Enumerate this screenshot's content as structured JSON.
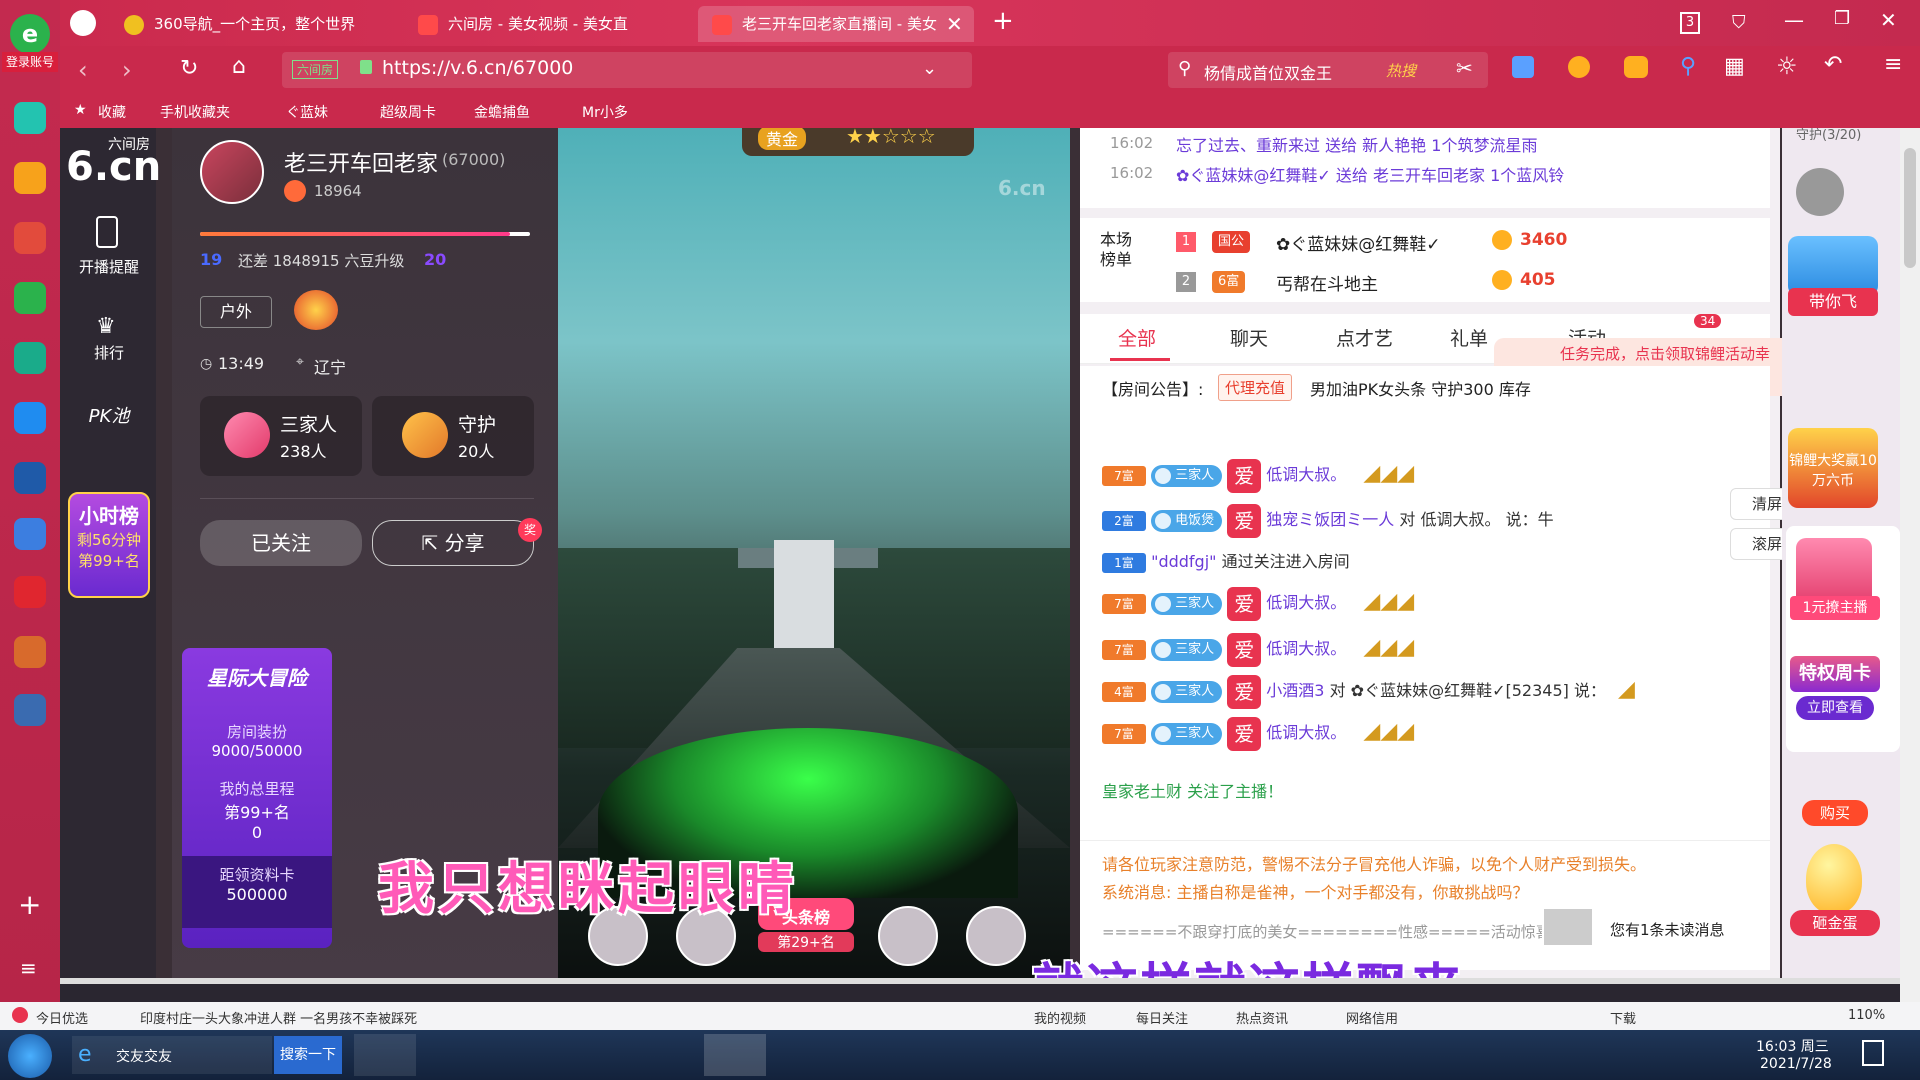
{
  "browser": {
    "tabs": [
      {
        "label": "360导航_一个主页，整个世界"
      },
      {
        "label": "六间房 - 美女视频 - 美女直"
      },
      {
        "label": "老三开车回老家直播间 - 美女"
      }
    ],
    "tab_count": "3",
    "url": "https://v.6.cn/67000",
    "site_badge": "六间房",
    "search_text": "杨倩成首位双金王",
    "search_hot": "热搜",
    "login_label": "登录账号",
    "favorites": [
      {
        "label": "收藏"
      },
      {
        "label": "手机收藏夹"
      },
      {
        "label": "ぐ蓝妹"
      },
      {
        "label": "超级周卡"
      },
      {
        "label": "金蟾捕鱼"
      },
      {
        "label": "Mr小多"
      }
    ]
  },
  "site_nav": {
    "logo_small": "六间房",
    "logo_big": "6.cn",
    "items": [
      {
        "label": "开播提醒"
      },
      {
        "label": "排行"
      },
      {
        "label": "PK池"
      }
    ],
    "hour_rank_title": "小时榜",
    "hour_rank_time": "剩56分钟",
    "hour_rank_pos": "第99+名"
  },
  "anchor": {
    "name": "老三开车回老家",
    "room_id": "(67000)",
    "fans": "18964",
    "level_from": "19",
    "upgrade_text": "还差 1848915 六豆升级",
    "level_to": "20",
    "category": "户外",
    "time": "13:49",
    "location": "辽宁",
    "family_label": "三家人",
    "family_count": "238人",
    "guard_label": "守护",
    "guard_count": "20人",
    "followed_label": "已关注",
    "share_label": "分享",
    "share_badge": "奖"
  },
  "adventure": {
    "title": "星际大冒险",
    "decor_label": "房间装扮",
    "decor_value": "9000/50000",
    "mileage_label": "我的总里程",
    "mileage_rank": "第99+名",
    "mileage_value": "0",
    "card_label": "距领资料卡",
    "card_value": "500000"
  },
  "video": {
    "level_badge": "黄金",
    "watermark": "6.cn",
    "subtitle1": "我只想眯起眼睛",
    "subtitle2": "就这样就这样飘来",
    "headline_badge": "头条榜",
    "headline_rank": "第29+名"
  },
  "chat_top": [
    {
      "time": "16:02",
      "text": "忘了过去、重新来过 送给 新人艳艳 1个筑梦流星雨"
    },
    {
      "time": "16:02",
      "text": "✿ぐ蓝妹妹@红舞鞋✓ 送给 老三开车回老家 1个蓝风铃"
    }
  ],
  "leaderboard": {
    "title": "本场榜单",
    "rows": [
      {
        "rank": "1",
        "badge": "国公",
        "name": "✿ぐ蓝妹妹@红舞鞋✓",
        "score": "3460"
      },
      {
        "rank": "2",
        "badge": "6富",
        "name": "丐帮在斗地主",
        "score": "405"
      }
    ]
  },
  "chat_tabs": [
    {
      "label": "全部"
    },
    {
      "label": "聊天"
    },
    {
      "label": "点才艺"
    },
    {
      "label": "礼单"
    },
    {
      "label": "活动"
    }
  ],
  "car_badge": "34",
  "task_tip": "任务完成，点击领取锦鲤活动幸运码~",
  "announcement": {
    "label": "【房间公告】:",
    "tag": "代理充值",
    "text": "男加油PK女头条 守护300 库存"
  },
  "messages": [
    {
      "level": "7富",
      "fan": "三家人",
      "name": "低调大叔。",
      "text": ""
    },
    {
      "level": "2富",
      "fan": "电饭煲",
      "name": "独宠ミ饭团ミ一人",
      "text": "对 低调大叔。 说：牛"
    },
    {
      "level": "1富",
      "fan": "",
      "name": "\"dddfgj\"",
      "text": "通过关注进入房间"
    },
    {
      "level": "7富",
      "fan": "三家人",
      "name": "低调大叔。",
      "text": ""
    },
    {
      "level": "7富",
      "fan": "三家人",
      "name": "低调大叔。",
      "text": ""
    },
    {
      "level": "4富",
      "fan": "三家人",
      "name": "小酒酒3",
      "text": "对 ✿ぐ蓝妹妹@红舞鞋✓[52345] 说："
    },
    {
      "level": "7富",
      "fan": "三家人",
      "name": "低调大叔。",
      "text": ""
    }
  ],
  "follow_msg": "皇家老土财 关注了主播！",
  "clear_label": "清屏",
  "scroll_label": "滚屏",
  "warning": "请各位玩家注意防范，警惕不法分子冒充他人诈骗，以免个人财产受到损失。",
  "system_msg": "系统消息: 主播自称是雀神，一个对手都没有，你敢挑战吗？",
  "bottom_feed": "======不跟穿打底的美女========性感=====活动惊喜多======",
  "unread": "您有1条未读消息",
  "far_right": {
    "guard_title": "守护(3/20)",
    "labels": [
      "带你飞",
      "1元撩主播",
      "特权周卡",
      "立即查看",
      "购买",
      "砸金蛋",
      "锦鲤大奖赢10万六币"
    ]
  },
  "statusbar": {
    "left1": "今日优选",
    "news": "印度村庄一头大象冲进人群 一名男孩不幸被踩死",
    "items": [
      "我的视频",
      "每日关注",
      "热点资讯",
      "网络信用",
      "下载"
    ],
    "zoom": "110%"
  },
  "taskbar": {
    "ie_label": "交友交友",
    "search_btn": "搜索一下",
    "time": "16:03 周三",
    "date": "2021/7/28"
  }
}
